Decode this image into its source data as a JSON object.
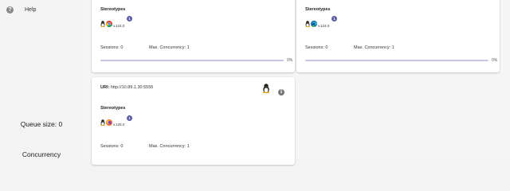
{
  "sidebar": {
    "help_label": "Help",
    "queue_size": "Queue size: 0",
    "concurrency_label": "Concurrency"
  },
  "nodes": [
    {
      "stereotypes_title": "Stereotypes",
      "browser": "chrome",
      "version": "v.124.0",
      "slots": "1",
      "sessions": "Sessions: 0",
      "max_concurrency": "Max. Concurrency: 1",
      "usage_percent": 0,
      "usage_label": "0%"
    },
    {
      "stereotypes_title": "Stereotypes",
      "browser": "edge",
      "version": "v.124.0",
      "slots": "1",
      "sessions": "Sessions: 0",
      "max_concurrency": "Max. Concurrency: 1",
      "usage_percent": 0,
      "usage_label": "0%"
    },
    {
      "uri_label": "URI:",
      "uri_value": "http://10.89.1.30:5555",
      "stereotypes_title": "Stereotypes",
      "browser": "firefox",
      "version": "v.125.0",
      "slots": "1",
      "sessions": "Sessions: 0",
      "max_concurrency": "Max. Concurrency: 1"
    }
  ],
  "colors": {
    "badge": "#5b5ea6",
    "progress": "#c5c7e2"
  }
}
